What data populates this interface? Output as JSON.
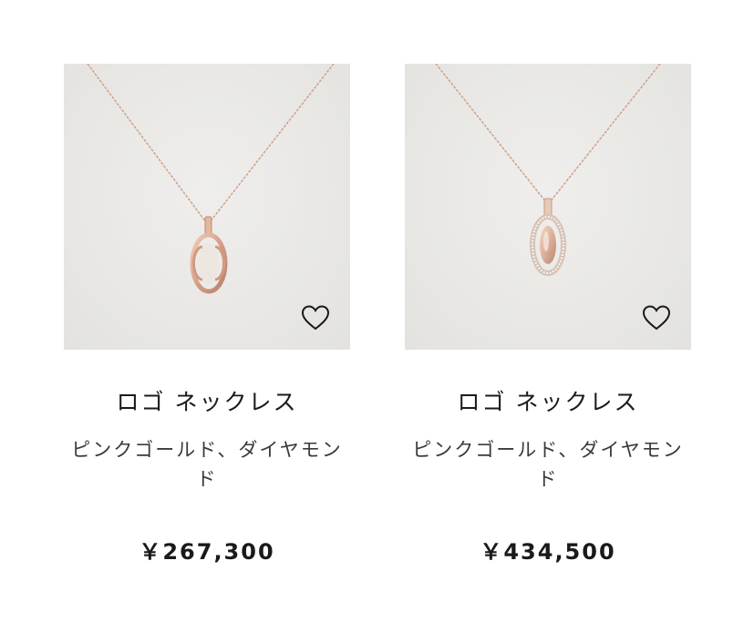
{
  "products": [
    {
      "name": "ロゴ ネックレス",
      "material": "ピンクゴールド、ダイヤモンド",
      "price": "￥267,300",
      "image_icon": "logo-necklace-pink-gold-image",
      "wishlist_icon": "heart-outline-icon"
    },
    {
      "name": "ロゴ ネックレス",
      "material": "ピンクゴールド、ダイヤモンド",
      "price": "￥434,500",
      "image_icon": "logo-necklace-diamond-pave-image",
      "wishlist_icon": "heart-outline-icon"
    }
  ],
  "colors": {
    "image_background": "#e9e8e5",
    "pink_gold": "#d7a88f",
    "text": "#1c1c1c"
  }
}
